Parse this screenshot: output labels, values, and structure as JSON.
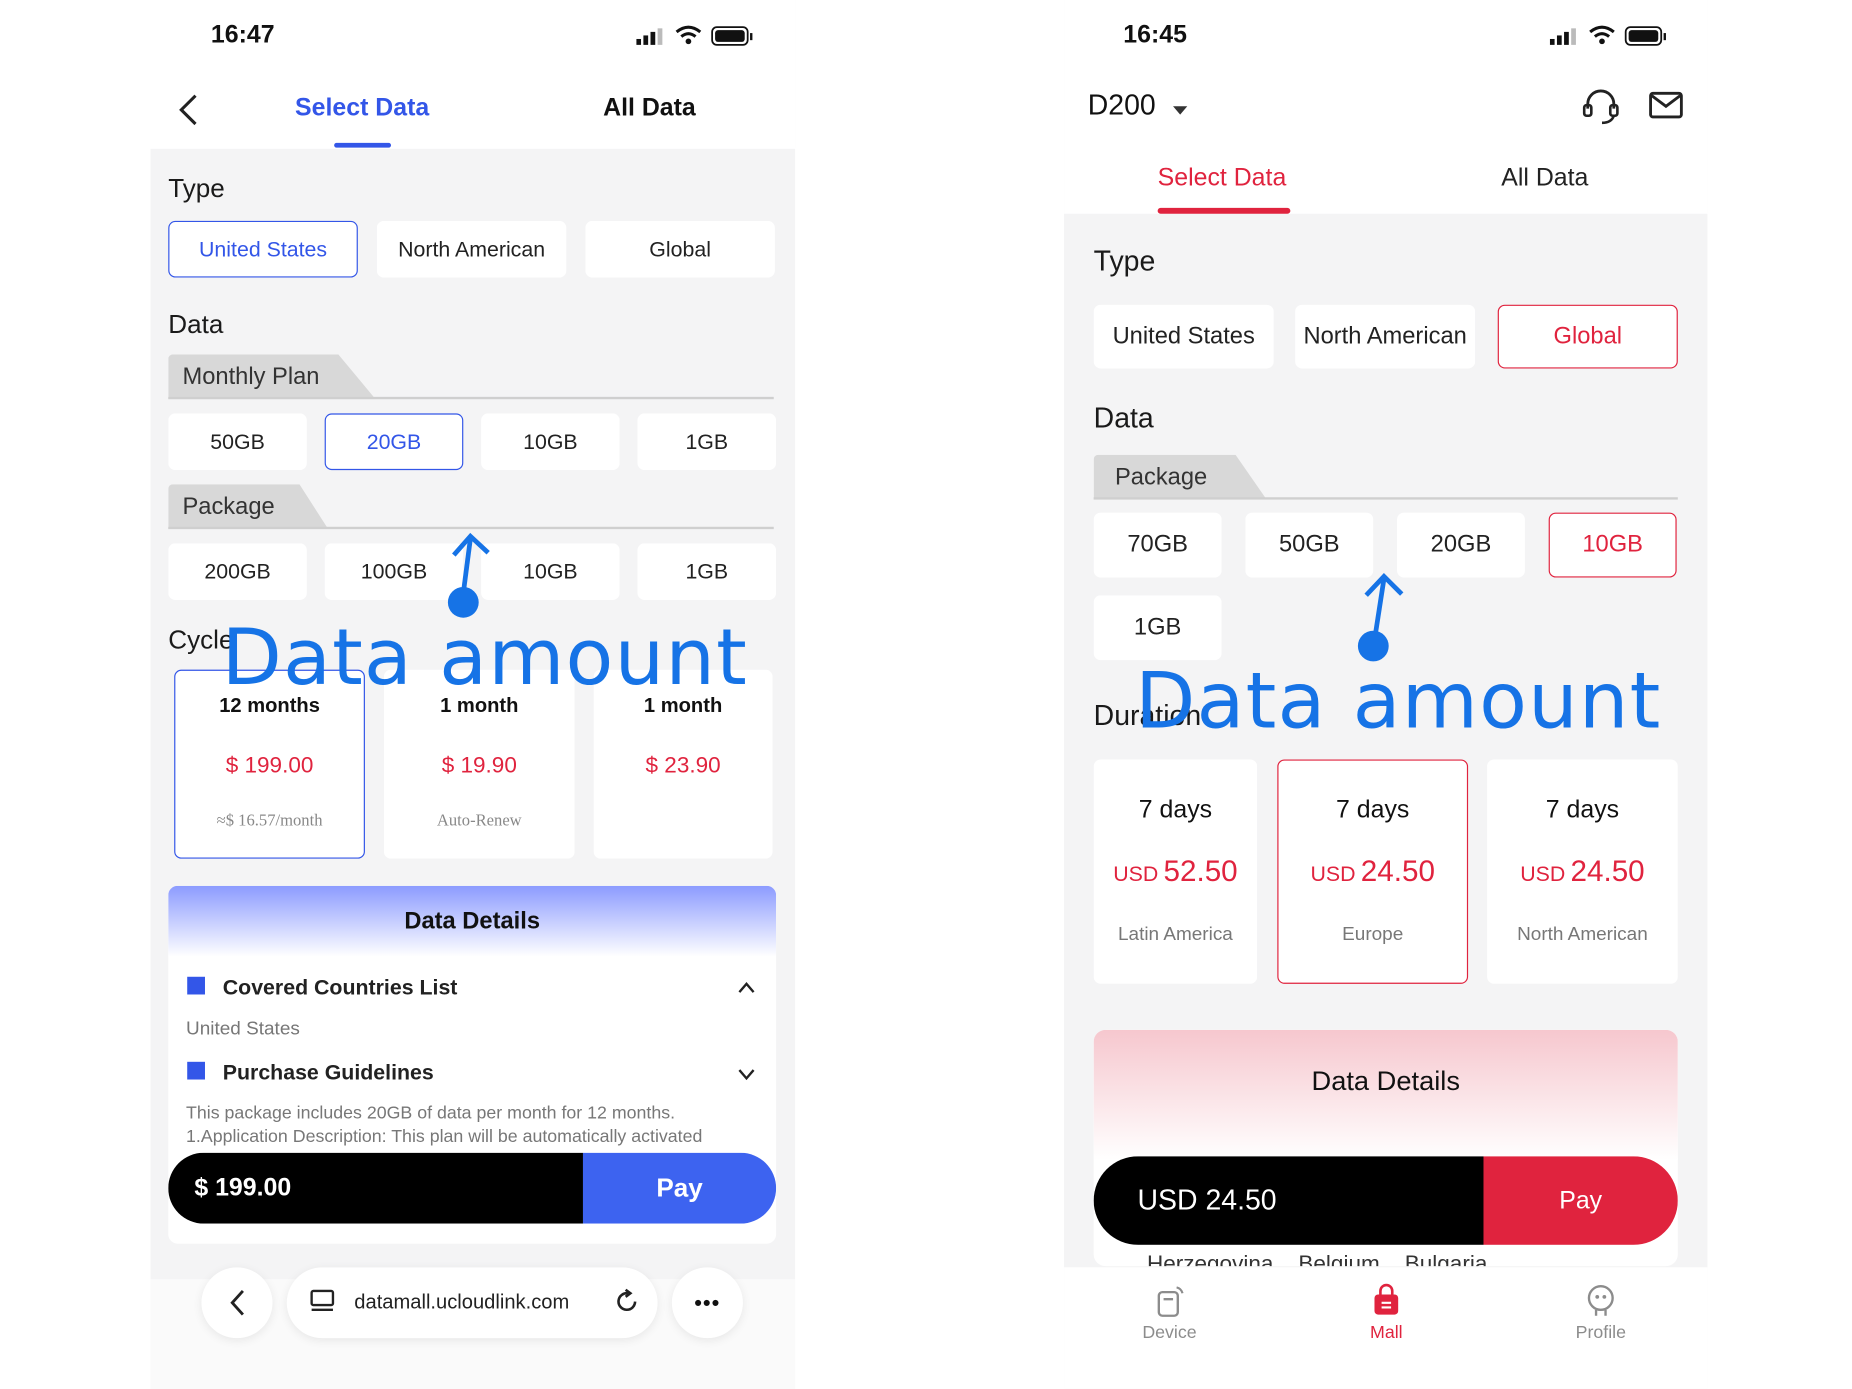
{
  "left": {
    "status": {
      "time": "16:47"
    },
    "tabs": [
      {
        "label": "Select Data"
      },
      {
        "label": "All Data"
      }
    ],
    "type_title": "Type",
    "types": [
      "United States",
      "North American",
      "Global"
    ],
    "data_title": "Data",
    "monthly_label": "Monthly Plan",
    "monthly_options": [
      "50GB",
      "20GB",
      "10GB",
      "1GB"
    ],
    "package_label": "Package",
    "package_options": [
      "200GB",
      "100GB",
      "10GB",
      "1GB"
    ],
    "cycle_title": "Cycle",
    "cycles": [
      {
        "period": "12 months",
        "price": "$ 199.00",
        "note": "≈$ 16.57/month"
      },
      {
        "period": "1 month",
        "price": "$ 19.90",
        "note": "Auto-Renew"
      },
      {
        "period": "1 month",
        "price": "$ 23.90",
        "note": ""
      }
    ],
    "details": {
      "title": "Data Details",
      "covered_label": "Covered Countries List",
      "covered_value": "United States",
      "guidelines_label": "Purchase Guidelines",
      "guidelines_text_1": "This package includes 20GB of data per month for 12 months.",
      "guidelines_text_2": "1.Application Description: This plan will be automatically activated"
    },
    "paybar": {
      "amount": "$ 199.00",
      "pay": "Pay"
    },
    "browser": {
      "url": "datamall.ucloudlink.com",
      "more": "•••"
    },
    "annotation": "Data amount"
  },
  "right": {
    "status": {
      "time": "16:45"
    },
    "device": "D200",
    "tabs": [
      {
        "label": "Select Data"
      },
      {
        "label": "All Data"
      }
    ],
    "type_title": "Type",
    "types": [
      "United States",
      "North American",
      "Global"
    ],
    "data_title": "Data",
    "package_label": "Package",
    "package_options": [
      "70GB",
      "50GB",
      "20GB",
      "10GB",
      "1GB"
    ],
    "duration_title": "Duration",
    "durations": [
      {
        "period": "7 days",
        "currency": "USD",
        "amount": "52.50",
        "region": "Latin America"
      },
      {
        "period": "7 days",
        "currency": "USD",
        "amount": "24.50",
        "region": "Europe"
      },
      {
        "period": "7 days",
        "currency": "USD",
        "amount": "24.50",
        "region": "North American"
      }
    ],
    "details": {
      "title": "Data Details",
      "peek": "Herzegovina    Belgium    Bulgaria"
    },
    "paybar": {
      "amount": "USD 24.50",
      "pay": "Pay"
    },
    "nav": [
      {
        "label": "Device"
      },
      {
        "label": "Mall"
      },
      {
        "label": "Profile"
      }
    ],
    "annotation": "Data amount"
  },
  "colors": {
    "blue_accent": "#3356e8",
    "red_accent": "#e0233e",
    "annotation": "#1673e6"
  }
}
